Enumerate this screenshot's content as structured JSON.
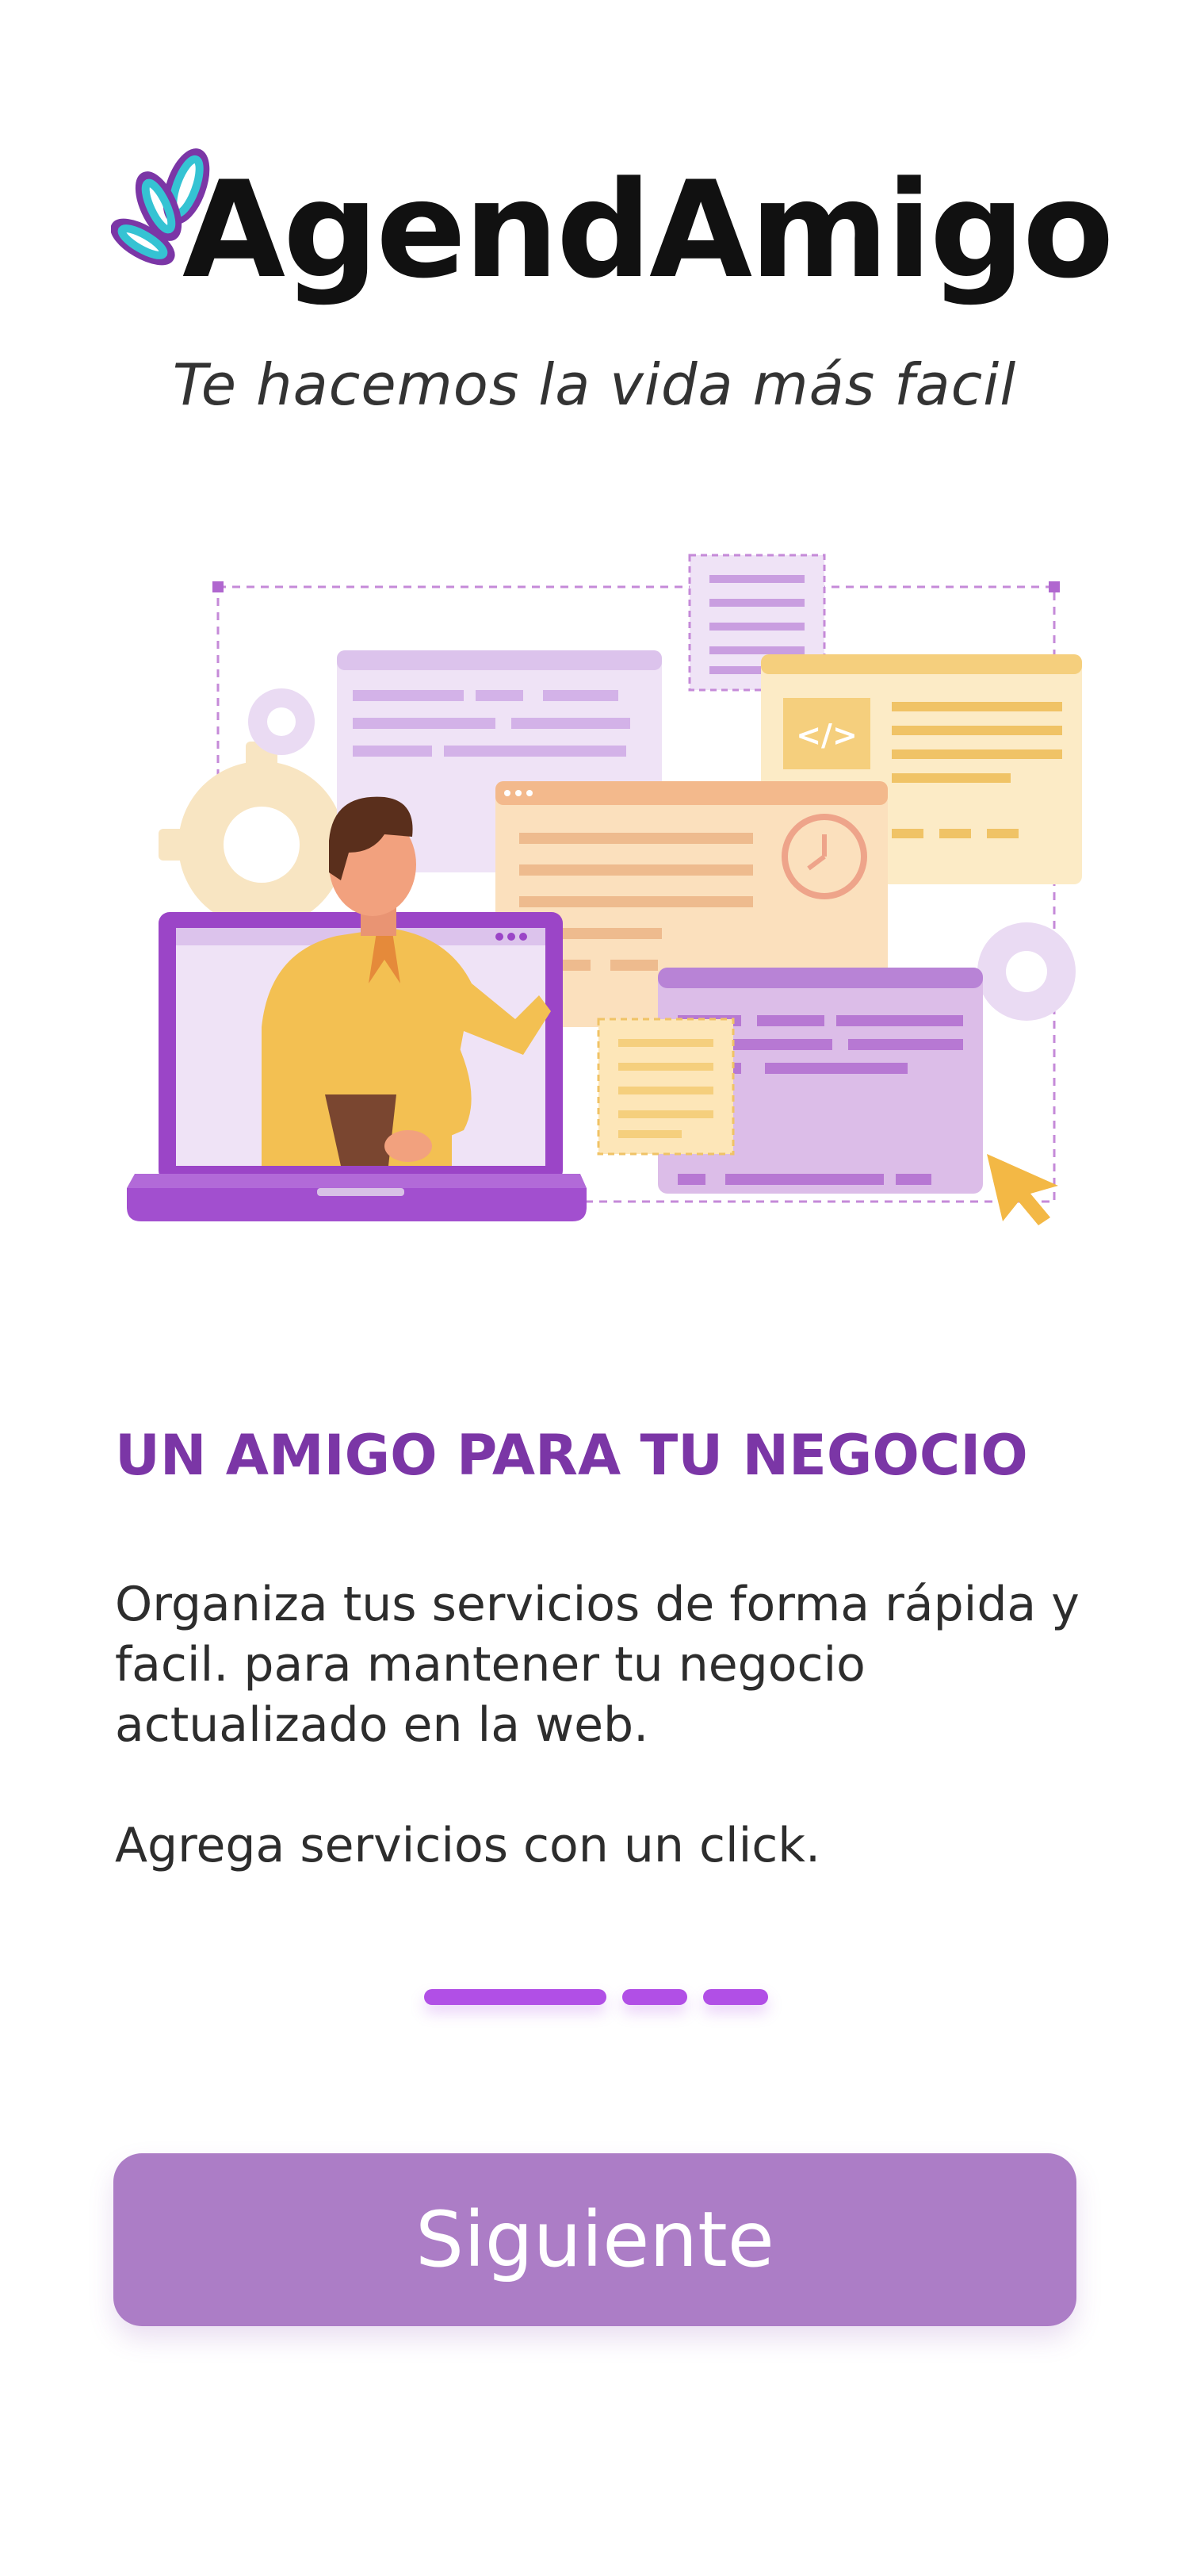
{
  "brand": {
    "name": "AgendAmigo",
    "tagline": "Te hacemos la vida más facil"
  },
  "illustration": {
    "icon": "web-developer-illustration",
    "code_badge": "</>"
  },
  "onboarding": {
    "heading": "UN AMIGO PARA TU NEGOCIO",
    "paragraph_1": "Organiza tus servicios de forma rápida y facil. para mantener tu negocio actualizado en la web.",
    "paragraph_2": "Agrega servicios con un click.",
    "step_current": 1,
    "step_total": 3
  },
  "actions": {
    "next_label": "Siguiente"
  },
  "colors": {
    "accent": "#7b36a6",
    "button": "#ac7dc6",
    "pager": "#b14fe6"
  }
}
